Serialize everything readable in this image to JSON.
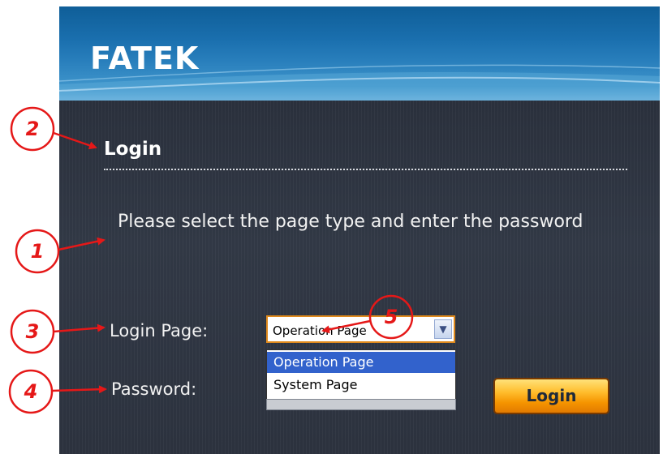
{
  "header": {
    "brand": "FATEK"
  },
  "login": {
    "title": "Login",
    "instructions": "Please select the page type and enter the password",
    "login_page_label": "Login Page:",
    "password_label": "Password:",
    "selected_page": "Operation Page",
    "dropdown_options": [
      "Operation Page",
      "System Page"
    ],
    "login_button": "Login"
  },
  "callouts": [
    "2",
    "1",
    "3",
    "4",
    "5"
  ],
  "colors": {
    "annotation": "#e51818",
    "header": "#1a6fae",
    "button": "#f59400",
    "highlight": "#3262cc"
  }
}
